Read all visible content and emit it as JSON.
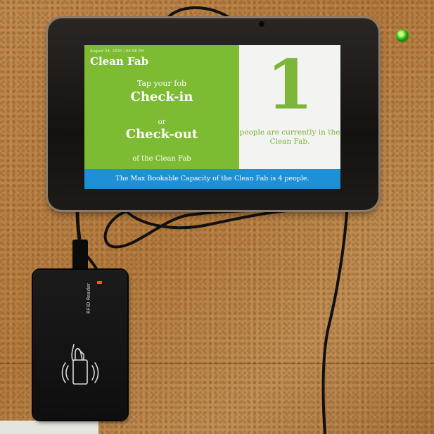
{
  "kiosk": {
    "timestamp": "August 24, 2020 | 06:58 PM",
    "brand": "Clean Fab",
    "tap_prompt": "Tap your fob",
    "check_in": "Check-in",
    "or": "or",
    "check_out": "Check-out",
    "of_location": "of the Clean Fab",
    "occupancy_count": "1",
    "occupancy_text": "people are currently in the Clean Fab.",
    "capacity_banner": "The Max Bookable Capacity of the Clean Fab is 4 people."
  },
  "reader": {
    "label": "RFID Reader",
    "icon": "rfid-card-tap-icon"
  },
  "colors": {
    "screen_green": "#7cbb32",
    "banner_blue": "#1f8fd6",
    "count_green": "#7cb53a",
    "cork": "#b9864a"
  }
}
